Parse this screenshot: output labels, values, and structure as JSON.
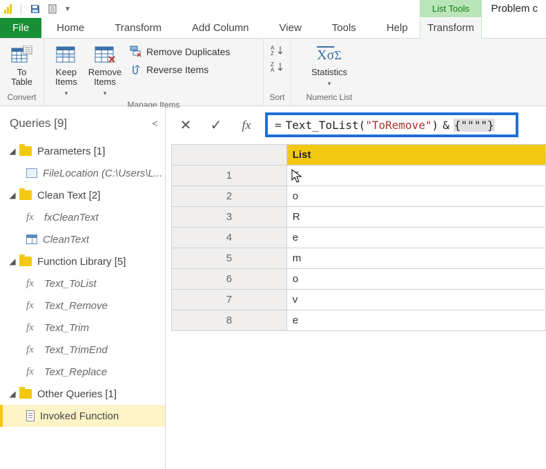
{
  "titlebar": {
    "context_tab": "List Tools",
    "doc_title_partial": "Problem c"
  },
  "ribbon_tabs": {
    "file": "File",
    "home": "Home",
    "transform": "Transform",
    "add_column": "Add Column",
    "view": "View",
    "tools": "Tools",
    "help": "Help",
    "ctx_transform": "Transform"
  },
  "ribbon": {
    "convert": {
      "to_table": "To\nTable",
      "label": "Convert"
    },
    "manage": {
      "keep": "Keep\nItems",
      "remove": "Remove\nItems",
      "remove_dup": "Remove Duplicates",
      "reverse": "Reverse Items",
      "label": "Manage Items"
    },
    "sort": {
      "label": "Sort"
    },
    "numeric": {
      "stats": "Statistics",
      "label": "Numeric List"
    }
  },
  "queries": {
    "title": "Queries [9]",
    "groups": [
      {
        "name": "Parameters [1]"
      },
      {
        "name": "Clean Text [2]"
      },
      {
        "name": "Function Library [5]"
      },
      {
        "name": "Other Queries [1]"
      }
    ],
    "items": {
      "filelocation": "FileLocation (C:\\Users\\L...",
      "fxcleantext": "fxCleanText",
      "cleantext": "CleanText",
      "text_tolist": "Text_ToList",
      "text_remove": "Text_Remove",
      "text_trim": "Text_Trim",
      "text_trimend": "Text_TrimEnd",
      "text_replace": "Text_Replace",
      "invoked": "Invoked Function"
    }
  },
  "formula": {
    "fn": "Text_ToList",
    "arg": "\"ToRemove\"",
    "tail1": " & ",
    "tail2": "{\"\"\"\"}"
  },
  "list": {
    "header": "List",
    "rows": [
      "T",
      "o",
      "R",
      "e",
      "m",
      "o",
      "v",
      "e"
    ]
  },
  "chart_data": {
    "type": "table",
    "title": "List",
    "categories": [
      1,
      2,
      3,
      4,
      5,
      6,
      7,
      8
    ],
    "values": [
      "T",
      "o",
      "R",
      "e",
      "m",
      "o",
      "v",
      "e"
    ]
  }
}
